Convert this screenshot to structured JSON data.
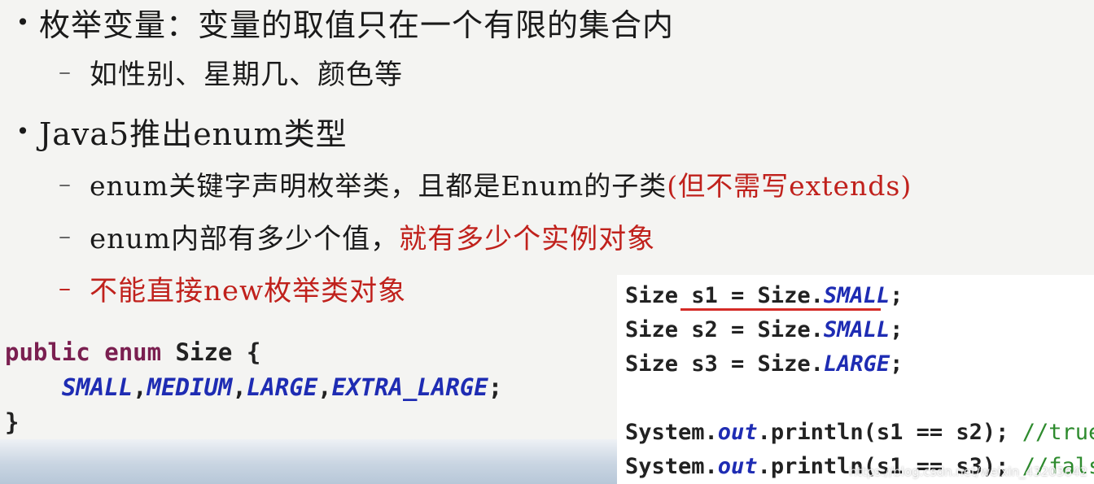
{
  "bullets": [
    {
      "text": "枚举变量：变量的取值只在一个有限的集合内"
    },
    {
      "text": "Java5推出enum类型"
    }
  ],
  "subs": {
    "sub1": "如性别、星期几、颜色等",
    "sub2_main": "enum关键字声明枚举类，且都是Enum的子类",
    "sub2_red": "(但不需写extends)",
    "sub3_main": "enum内部有多少个值，",
    "sub3_red": "就有多少个实例对象",
    "sub4": "不能直接new枚举类对象"
  },
  "enum_code": {
    "kw1": "public",
    "kw2": "enum",
    "name": "Size {",
    "c1": "SMALL",
    "c2": "MEDIUM",
    "c3": "LARGE",
    "c4": "EXTRA_LARGE",
    "sep": ",",
    "end": ";",
    "close": "}"
  },
  "right_code": {
    "l1a": "Size s1 = Size.",
    "l1b": "SMALL",
    "l1c": ";",
    "l2a": "Size s2 = Size.",
    "l2b": "SMALL",
    "l2c": ";",
    "l3a": "Size s3 = Size.",
    "l3b": "LARGE",
    "l3c": ";",
    "l4a": "System.",
    "l4b": "out",
    "l4c": ".println(s1 == s2); ",
    "l4d": "//true",
    "l5a": "System.",
    "l5b": "out",
    "l5c": ".println(s1 == s3); ",
    "l5d": "//false"
  },
  "watermark": "https://blog.csdn.net/weixin_43203642",
  "colors": {
    "red": "#c0211c",
    "keyword": "#7a1f50",
    "constant": "#1e2cb3",
    "comment": "#2e8b2e"
  }
}
